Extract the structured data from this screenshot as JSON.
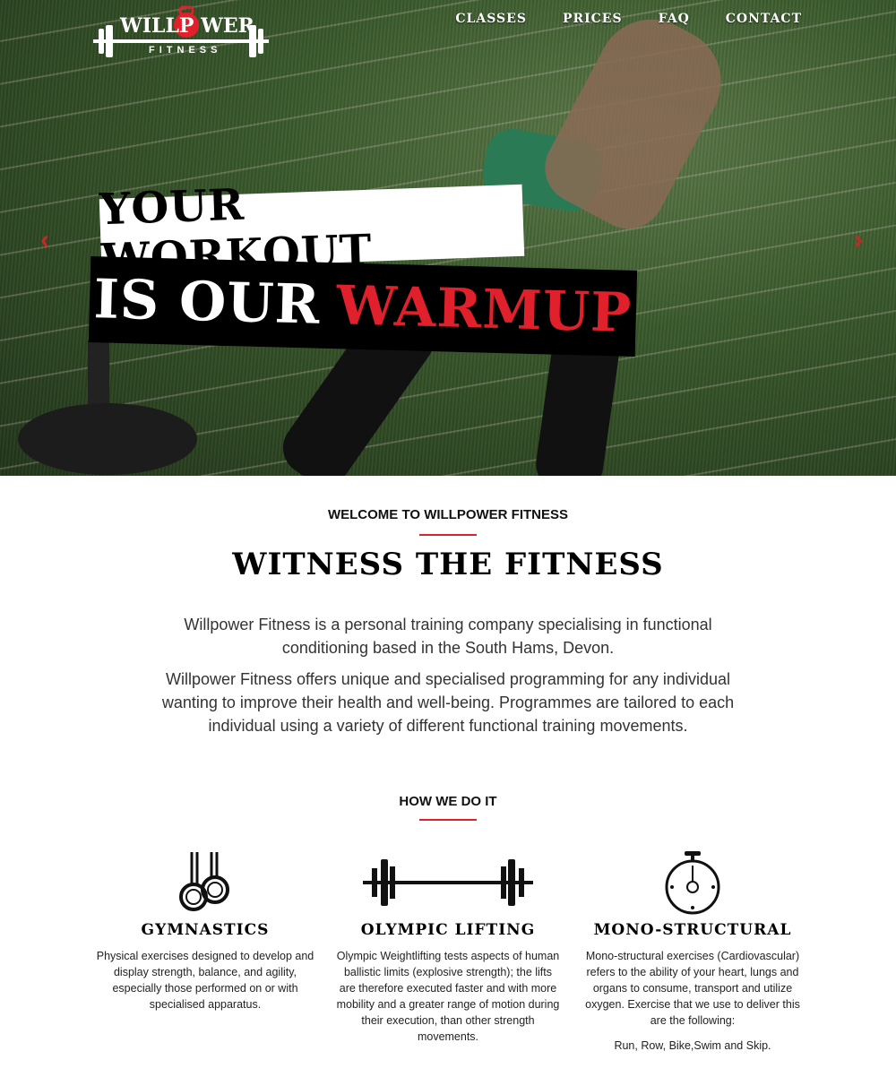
{
  "nav": {
    "logo_main": "WILLP WER",
    "logo_sub": "FITNESS",
    "items": [
      "CLASSES",
      "PRICES",
      "FAQ",
      "CONTACT"
    ]
  },
  "hero": {
    "line1": "YOUR WORKOUT",
    "line2_white": "IS OUR",
    "line2_red": "WARMUP",
    "prev_arrow": "‹",
    "next_arrow": "›"
  },
  "welcome": {
    "label": "WELCOME TO WILLPOWER FITNESS",
    "title": "WITNESS THE FITNESS",
    "para1": "Willpower Fitness is a personal training company specialising in functional conditioning based in the South Hams, Devon.",
    "para2": "Willpower Fitness offers  unique and specialised programming for any individual wanting to improve their health and well-being.  Programmes are tailored to each individual using a variety of different functional training movements."
  },
  "how": {
    "label": "HOW WE DO IT",
    "features": [
      {
        "icon": "rings-icon",
        "title": "GYMNASTICS",
        "text": "Physical exercises designed to develop and display strength, balance, and agility, especially those performed on or with specialised apparatus.",
        "extra": ""
      },
      {
        "icon": "barbell-icon",
        "title": "OLYMPIC LIFTING",
        "text": "Olympic Weightlifting tests aspects of human ballistic limits (explosive strength); the lifts are therefore executed faster and with more mobility and a greater range of motion during their execution, than other strength movements.",
        "extra": ""
      },
      {
        "icon": "stopwatch-icon",
        "title": "MONO-STRUCTURAL",
        "text": "Mono-structural exercises (Cardiovascular) refers to the ability of your heart, lungs and organs to consume, transport and utilize oxygen. Exercise that we use to deliver this are the following:",
        "extra": "Run, Row, Bike,Swim and Skip."
      }
    ]
  },
  "colors": {
    "accent_red": "#e0202a",
    "grass_green": "#3a5a2c"
  }
}
